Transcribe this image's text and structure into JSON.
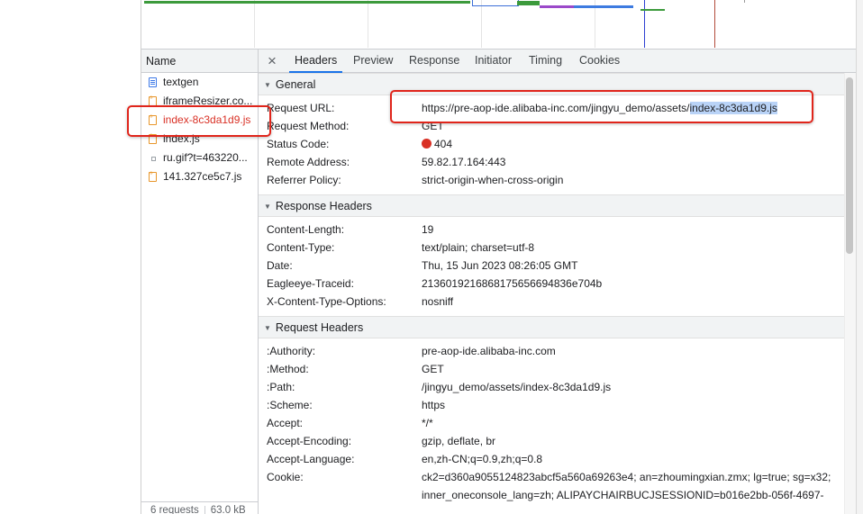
{
  "request_list": {
    "header": "Name",
    "items": [
      {
        "name": "textgen",
        "icon": "document-icon",
        "selected": false
      },
      {
        "name": "iframeResizer.co...",
        "icon": "script-icon",
        "selected": false
      },
      {
        "name": "index-8c3da1d9.js",
        "icon": "script-icon",
        "selected": true
      },
      {
        "name": "index.js",
        "icon": "script-icon",
        "selected": false
      },
      {
        "name": "ru.gif?t=463220...",
        "icon": "image-icon",
        "selected": false
      },
      {
        "name": "141.327ce5c7.js",
        "icon": "script-icon",
        "selected": false
      }
    ],
    "footer_requests": "6 requests",
    "footer_size": "63.0 kB"
  },
  "tabs": {
    "close_icon": "×",
    "items": [
      "Headers",
      "Preview",
      "Response",
      "Initiator",
      "Timing",
      "Cookies"
    ],
    "active": "Headers"
  },
  "general": {
    "title": "General",
    "request_url_key": "Request URL:",
    "request_url_prefix": "https://pre-aop-ide.alibaba-inc.com/jingyu_demo/assets/",
    "request_url_highlight": "index-8c3da1d9.js",
    "method_key": "Request Method:",
    "method": "GET",
    "status_key": "Status Code:",
    "status": "404",
    "remote_key": "Remote Address:",
    "remote": "59.82.17.164:443",
    "referrer_key": "Referrer Policy:",
    "referrer": "strict-origin-when-cross-origin"
  },
  "response_headers": {
    "title": "Response Headers",
    "rows": [
      {
        "k": "Content-Length:",
        "v": "19"
      },
      {
        "k": "Content-Type:",
        "v": "text/plain; charset=utf-8"
      },
      {
        "k": "Date:",
        "v": "Thu, 15 Jun 2023 08:26:05 GMT"
      },
      {
        "k": "Eagleeye-Traceid:",
        "v": "2136019216868175656694836e704b"
      },
      {
        "k": "X-Content-Type-Options:",
        "v": "nosniff"
      }
    ]
  },
  "request_headers": {
    "title": "Request Headers",
    "rows": [
      {
        "k": ":Authority:",
        "v": "pre-aop-ide.alibaba-inc.com"
      },
      {
        "k": ":Method:",
        "v": "GET"
      },
      {
        "k": ":Path:",
        "v": "/jingyu_demo/assets/index-8c3da1d9.js"
      },
      {
        "k": ":Scheme:",
        "v": "https"
      },
      {
        "k": "Accept:",
        "v": "*/*"
      },
      {
        "k": "Accept-Encoding:",
        "v": "gzip, deflate, br"
      },
      {
        "k": "Accept-Language:",
        "v": "en,zh-CN;q=0.9,zh;q=0.8"
      },
      {
        "k": "Cookie:",
        "v": "ck2=d360a9055124823abcf5a560a69263e4; an=zhoumingxian.zmx; lg=true; sg=x32;"
      },
      {
        "k": "",
        "v": "inner_oneconsole_lang=zh; ALIPAYCHAIRBUCJSESSIONID=b016e2bb-056f-4697-"
      }
    ]
  },
  "colors": {
    "accent": "#1a73e8",
    "error": "#d93025",
    "annotation": "#e0251b",
    "highlight": "#b9d3f7"
  }
}
